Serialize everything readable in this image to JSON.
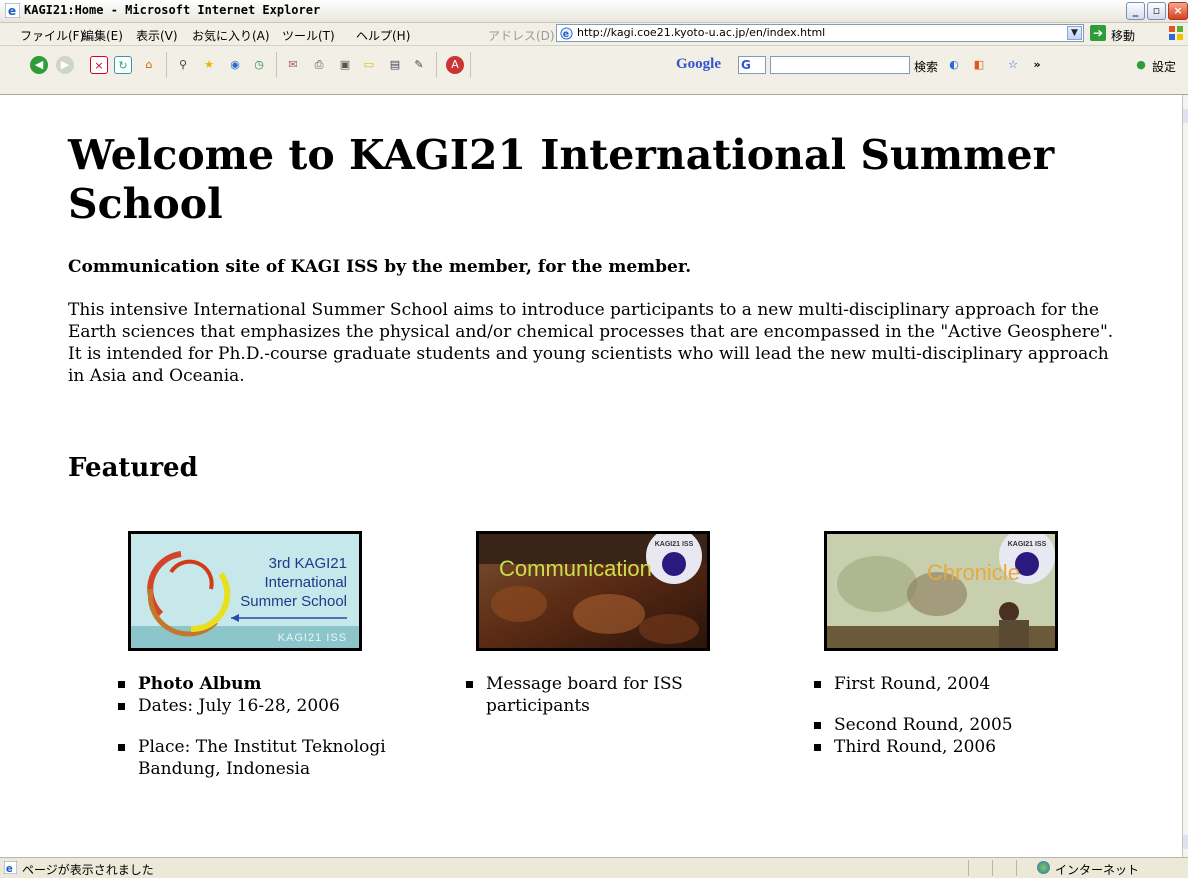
{
  "window": {
    "title": "KAGI21:Home - Microsoft Internet Explorer"
  },
  "menu": {
    "items": [
      "ファイル(F)",
      "編集(E)",
      "表示(V)",
      "お気に入り(A)",
      "ツール(T)",
      "ヘルプ(H)"
    ],
    "address_label": "アドレス(D)",
    "url": "http://kagi.coe21.kyoto-u.ac.jp/en/index.html",
    "go_label": "移動"
  },
  "toolbar": {
    "google_label": "Google",
    "google_box": "G",
    "search_label": "検索",
    "settings_label": "設定"
  },
  "page": {
    "title": "Welcome to KAGI21 International Summer School",
    "tagline": "Communication site of KAGI ISS by the member, for the member.",
    "intro": "This intensive International Summer School aims to introduce participants to a new multi-disciplinary approach for the Earth sciences that emphasizes the physical and/or chemical processes that are encompassed in the \"Active Geosphere\". It is intended for Ph.D.-course graduate students and young scientists who will lead the new multi-disciplinary approach in Asia and Oceania.",
    "featured_heading": "Featured",
    "features": [
      {
        "image_text": [
          "3rd KAGI21",
          "International",
          "Summer School"
        ],
        "image_footer": "KAGI21 ISS",
        "items": [
          "Photo Album",
          "Dates: July 16-28, 2006",
          "Place: The Institut Teknologi Bandung, Indonesia"
        ]
      },
      {
        "image_text": "Communication",
        "badge": "KAGI21 ISS",
        "items": [
          "Message board for ISS participants"
        ]
      },
      {
        "image_text": "Chronicle",
        "badge": "KAGI21 ISS",
        "items": [
          "First Round, 2004",
          "Second Round, 2005",
          "Third Round, 2006"
        ]
      }
    ]
  },
  "status": {
    "text": "ページが表示されました",
    "zone": "インターネット"
  }
}
